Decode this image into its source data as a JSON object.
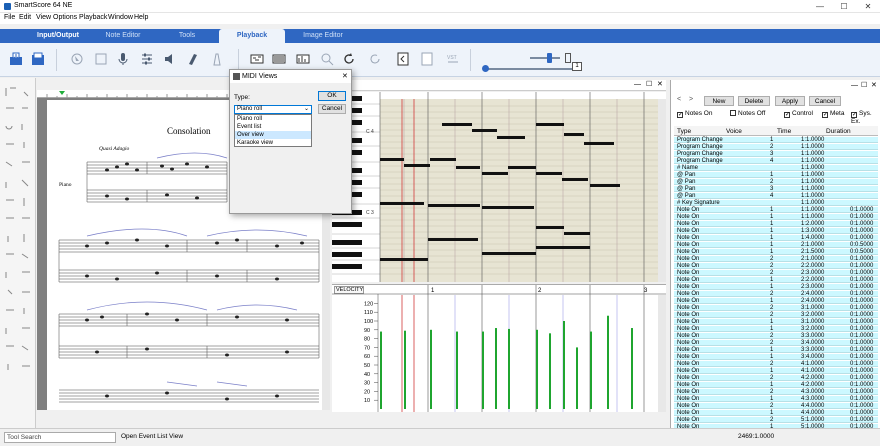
{
  "window": {
    "title": "SmartScore 64 NE",
    "controls": [
      "—",
      "☐",
      "✕"
    ]
  },
  "menu": [
    "File",
    "Edit",
    "View",
    "Options",
    "Playback",
    "Window",
    "Help"
  ],
  "ribbon": {
    "tabs": [
      "Input/Output",
      "Note Editor",
      "Tools",
      "Playback",
      "Image Editor"
    ],
    "active": "Playback"
  },
  "toolbar": {
    "tempo_value": "1"
  },
  "score": {
    "title": "Consolation",
    "tempo_marking": "Quasi Adagio",
    "instrument": "Piano"
  },
  "midi": {
    "measures": [
      "4",
      "5"
    ],
    "velocity_label": "VELOCITY",
    "velocity_measures": [
      "1",
      "2",
      "3"
    ],
    "velocity_ticks": [
      "120",
      "110",
      "100",
      "90",
      "80",
      "70",
      "60",
      "50",
      "40",
      "30",
      "20",
      "10"
    ],
    "velocities": [
      88,
      89,
      90,
      88,
      88,
      92,
      91,
      90,
      86,
      100,
      70,
      88,
      106,
      92
    ]
  },
  "dialog": {
    "title": "MIDI Views",
    "type_label": "Type:",
    "selected": "Piano roll",
    "options": [
      "Piano roll",
      "Event list",
      "Over view",
      "Karaoke view"
    ],
    "highlighted": "Over view",
    "ok_label": "OK",
    "cancel_label": "Cancel"
  },
  "event_list": {
    "buttons": [
      "New",
      "Delete",
      "Apply",
      "Cancel"
    ],
    "filters": [
      {
        "label": "Notes On",
        "checked": true
      },
      {
        "label": "Notes Off",
        "checked": false
      },
      {
        "label": "Control",
        "checked": true
      },
      {
        "label": "Meta",
        "checked": true
      },
      {
        "label": "Sys. Ex.",
        "checked": true
      }
    ],
    "columns": [
      "Type",
      "Voice",
      "Time",
      "Duration"
    ],
    "rows": [
      [
        "Program Change",
        "1",
        "1:1.0000",
        ""
      ],
      [
        "Program Change",
        "2",
        "1:1.0000",
        ""
      ],
      [
        "Program Change",
        "3",
        "1:1.0000",
        ""
      ],
      [
        "Program Change",
        "4",
        "1:1.0000",
        ""
      ],
      [
        "# Name",
        "",
        "1:1.0000",
        ""
      ],
      [
        "@ Pan",
        "1",
        "1:1.0000",
        ""
      ],
      [
        "@ Pan",
        "2",
        "1:1.0000",
        ""
      ],
      [
        "@ Pan",
        "3",
        "1:1.0000",
        ""
      ],
      [
        "@ Pan",
        "4",
        "1:1.0000",
        ""
      ],
      [
        "# Key Signature",
        "",
        "1:1.0000",
        ""
      ],
      [
        "Note On",
        "1",
        "1:1.0000",
        "0:1.0000"
      ],
      [
        "Note On",
        "1",
        "1:1.0000",
        "0:1.0000"
      ],
      [
        "Note On",
        "1",
        "1:2.0000",
        "0:1.0000"
      ],
      [
        "Note On",
        "1",
        "1:3.0000",
        "0:1.0000"
      ],
      [
        "Note On",
        "1",
        "1:4.0000",
        "0:1.0000"
      ],
      [
        "Note On",
        "1",
        "2:1.0000",
        "0:0.5000"
      ],
      [
        "Note On",
        "1",
        "2:1.5000",
        "0:0.5000"
      ],
      [
        "Note On",
        "2",
        "2:1.0000",
        "0:1.0000"
      ],
      [
        "Note On",
        "2",
        "2:2.0000",
        "0:1.0000"
      ],
      [
        "Note On",
        "2",
        "2:3.0000",
        "0:1.0000"
      ],
      [
        "Note On",
        "1",
        "2:2.0000",
        "0:1.0000"
      ],
      [
        "Note On",
        "1",
        "2:3.0000",
        "0:1.0000"
      ],
      [
        "Note On",
        "2",
        "2:4.0000",
        "0:1.0000"
      ],
      [
        "Note On",
        "1",
        "2:4.0000",
        "0:1.0000"
      ],
      [
        "Note On",
        "2",
        "3:1.0000",
        "0:1.0000"
      ],
      [
        "Note On",
        "2",
        "3:2.0000",
        "0:1.0000"
      ],
      [
        "Note On",
        "1",
        "3:1.0000",
        "0:1.0000"
      ],
      [
        "Note On",
        "1",
        "3:2.0000",
        "0:1.0000"
      ],
      [
        "Note On",
        "2",
        "3:3.0000",
        "0:1.0000"
      ],
      [
        "Note On",
        "2",
        "3:4.0000",
        "0:1.0000"
      ],
      [
        "Note On",
        "1",
        "3:3.0000",
        "0:1.0000"
      ],
      [
        "Note On",
        "1",
        "3:4.0000",
        "0:1.0000"
      ],
      [
        "Note On",
        "2",
        "4:1.0000",
        "0:1.0000"
      ],
      [
        "Note On",
        "1",
        "4:1.0000",
        "0:1.0000"
      ],
      [
        "Note On",
        "2",
        "4:2.0000",
        "0:1.0000"
      ],
      [
        "Note On",
        "1",
        "4:2.0000",
        "0:1.0000"
      ],
      [
        "Note On",
        "2",
        "4:3.0000",
        "0:1.0000"
      ],
      [
        "Note On",
        "1",
        "4:3.0000",
        "0:1.0000"
      ],
      [
        "Note On",
        "2",
        "4:4.0000",
        "0:1.0000"
      ],
      [
        "Note On",
        "1",
        "4:4.0000",
        "0:1.0000"
      ],
      [
        "Note On",
        "2",
        "5:1.0000",
        "0:1.0000"
      ],
      [
        "Note On",
        "1",
        "5:1.0000",
        "0:1.0000"
      ]
    ]
  },
  "status": {
    "search_placeholder": "Tool Search",
    "message": "Open Event List View",
    "position": "2469:1.0000"
  }
}
